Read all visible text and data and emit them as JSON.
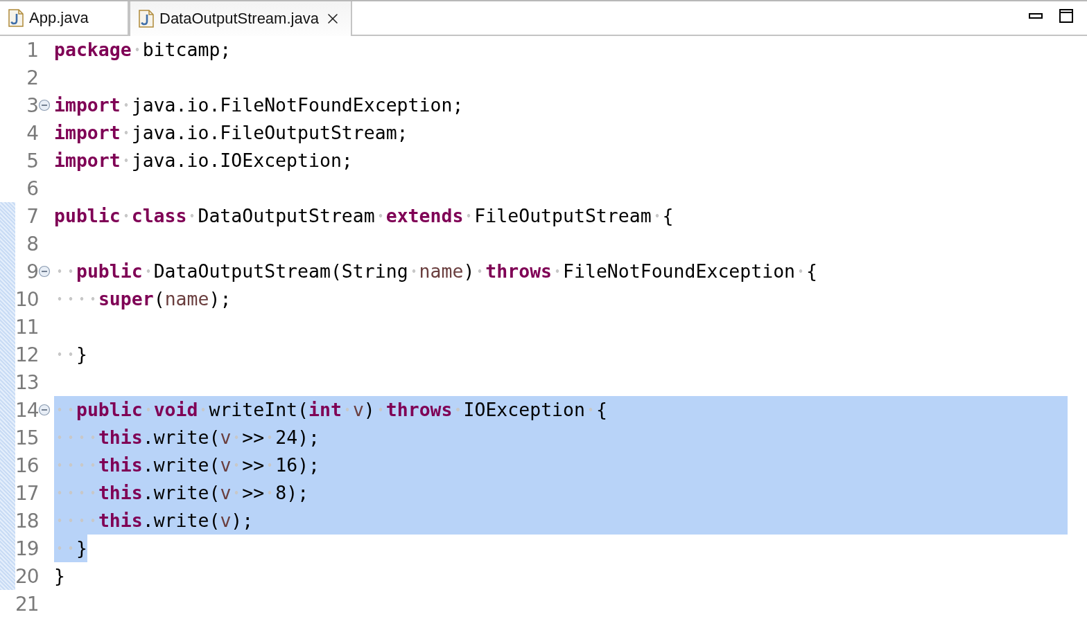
{
  "tabs": [
    {
      "label": "App.java",
      "selected": false,
      "closable": false
    },
    {
      "label": "DataOutputStream.java",
      "selected": true,
      "closable": true
    }
  ],
  "lines": [
    {
      "number": "1",
      "fold": false,
      "range": false,
      "selected": false,
      "eol_selected": false,
      "tokens": [
        {
          "kind": "keyword",
          "text": "package"
        },
        {
          "kind": "plain",
          "text": " bitcamp;"
        }
      ]
    },
    {
      "number": "2",
      "fold": false,
      "range": false,
      "eol_selected": false
    },
    {
      "number": "3",
      "fold": true,
      "range": false,
      "selected": false,
      "eol_selected": false,
      "tokens": [
        {
          "kind": "keyword",
          "text": "import"
        },
        {
          "kind": "plain",
          "text": " java.io.FileNotFoundException;"
        }
      ]
    },
    {
      "number": "4",
      "fold": false,
      "range": false,
      "selected": false,
      "eol_selected": false,
      "tokens": [
        {
          "kind": "keyword",
          "text": "import"
        },
        {
          "kind": "plain",
          "text": " java.io.FileOutputStream;"
        }
      ]
    },
    {
      "number": "5",
      "fold": false,
      "range": false,
      "selected": false,
      "eol_selected": false,
      "tokens": [
        {
          "kind": "keyword",
          "text": "import"
        },
        {
          "kind": "plain",
          "text": " java.io.IOException;"
        }
      ]
    },
    {
      "number": "6",
      "fold": false,
      "range": false,
      "eol_selected": false
    },
    {
      "number": "7",
      "fold": false,
      "range": true,
      "selected": false,
      "eol_selected": false,
      "tokens": [
        {
          "kind": "keyword",
          "text": "public class"
        },
        {
          "kind": "plain",
          "text": " DataOutputStream "
        },
        {
          "kind": "keyword",
          "text": "extends"
        },
        {
          "kind": "plain",
          "text": " FileOutputStream {"
        }
      ]
    },
    {
      "number": "8",
      "fold": false,
      "range": true,
      "eol_selected": false
    },
    {
      "number": "9",
      "fold": true,
      "range": true,
      "selected": false,
      "eol_selected": false,
      "tokens": [
        {
          "kind": "keyword",
          "text": "  public"
        },
        {
          "kind": "plain",
          "text": " DataOutputStream(String "
        },
        {
          "kind": "variable",
          "text": "name"
        },
        {
          "kind": "plain",
          "text": ") "
        },
        {
          "kind": "keyword",
          "text": "throws"
        },
        {
          "kind": "plain",
          "text": " FileNotFoundException {"
        }
      ]
    },
    {
      "number": "10",
      "fold": false,
      "range": true,
      "selected": false,
      "eol_selected": false,
      "tokens": [
        {
          "kind": "keyword",
          "text": "    super"
        },
        {
          "kind": "plain",
          "text": "("
        },
        {
          "kind": "variable",
          "text": "name"
        },
        {
          "kind": "plain",
          "text": ");"
        }
      ]
    },
    {
      "number": "11",
      "fold": false,
      "range": true,
      "eol_selected": false
    },
    {
      "number": "12",
      "fold": false,
      "range": true,
      "selected": false,
      "eol_selected": false,
      "tokens": [
        {
          "kind": "plain",
          "text": "  }"
        }
      ]
    },
    {
      "number": "13",
      "fold": false,
      "range": true,
      "eol_selected": false
    },
    {
      "number": "14",
      "fold": true,
      "range": true,
      "selected": true,
      "eol_selected": true,
      "tokens": [
        {
          "kind": "keyword",
          "text": "  public void"
        },
        {
          "kind": "plain",
          "text": " writeInt("
        },
        {
          "kind": "keyword",
          "text": "int"
        },
        {
          "kind": "variable",
          "text": " v"
        },
        {
          "kind": "plain",
          "text": ") "
        },
        {
          "kind": "keyword",
          "text": "throws"
        },
        {
          "kind": "plain",
          "text": " IOException {"
        }
      ]
    },
    {
      "number": "15",
      "fold": false,
      "range": true,
      "selected": true,
      "eol_selected": true,
      "tokens": [
        {
          "kind": "keyword",
          "text": "    this"
        },
        {
          "kind": "plain",
          "text": ".write("
        },
        {
          "kind": "variable",
          "text": "v"
        },
        {
          "kind": "plain",
          "text": " >> 24);"
        }
      ]
    },
    {
      "number": "16",
      "fold": false,
      "range": true,
      "selected": true,
      "eol_selected": true,
      "tokens": [
        {
          "kind": "keyword",
          "text": "    this"
        },
        {
          "kind": "plain",
          "text": ".write("
        },
        {
          "kind": "variable",
          "text": "v"
        },
        {
          "kind": "plain",
          "text": " >> 16);"
        }
      ]
    },
    {
      "number": "17",
      "fold": false,
      "range": true,
      "selected": true,
      "eol_selected": true,
      "tokens": [
        {
          "kind": "keyword",
          "text": "    this"
        },
        {
          "kind": "plain",
          "text": ".write("
        },
        {
          "kind": "variable",
          "text": "v"
        },
        {
          "kind": "plain",
          "text": " >> 8);"
        }
      ]
    },
    {
      "number": "18",
      "fold": false,
      "range": true,
      "selected": true,
      "eol_selected": true,
      "tokens": [
        {
          "kind": "keyword",
          "text": "    this"
        },
        {
          "kind": "plain",
          "text": ".write("
        },
        {
          "kind": "variable",
          "text": "v"
        },
        {
          "kind": "plain",
          "text": ");"
        }
      ]
    },
    {
      "number": "19",
      "fold": false,
      "range": true,
      "selected": true,
      "eol_selected": false,
      "tokens": [
        {
          "kind": "plain",
          "text": "  }"
        }
      ]
    },
    {
      "number": "20",
      "fold": false,
      "range": true,
      "selected": false,
      "eol_selected": false,
      "tokens": [
        {
          "kind": "plain",
          "text": "}"
        }
      ]
    },
    {
      "number": "21",
      "fold": false,
      "range": false,
      "eol_selected": false
    }
  ]
}
